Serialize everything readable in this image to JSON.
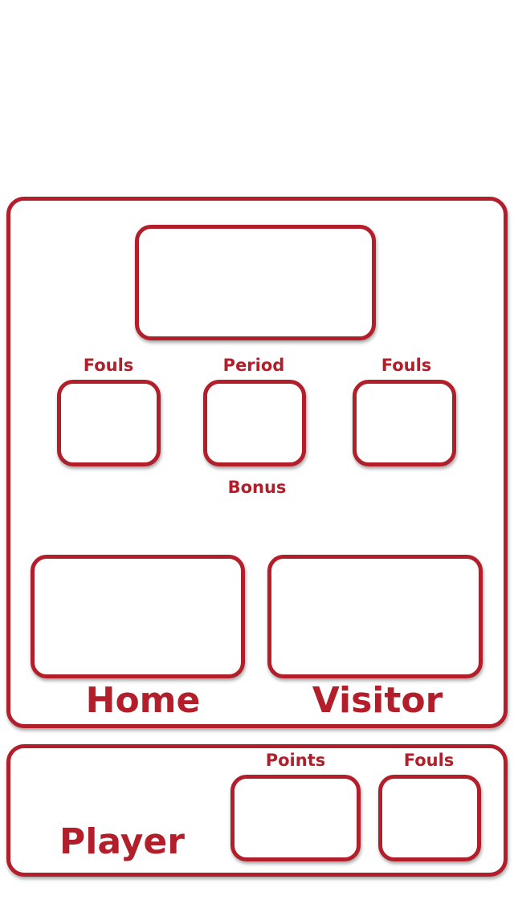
{
  "scoreboard": {
    "home_fouls_label": "Fouls",
    "period_label": "Period",
    "visitor_fouls_label": "Fouls",
    "bonus_label": "Bonus",
    "home_label": "Home",
    "visitor_label": "Visitor"
  },
  "player": {
    "title": "Player",
    "points_label": "Points",
    "fouls_label": "Fouls"
  },
  "colors": {
    "accent": "#b21f2a",
    "background": "#ffffff"
  }
}
